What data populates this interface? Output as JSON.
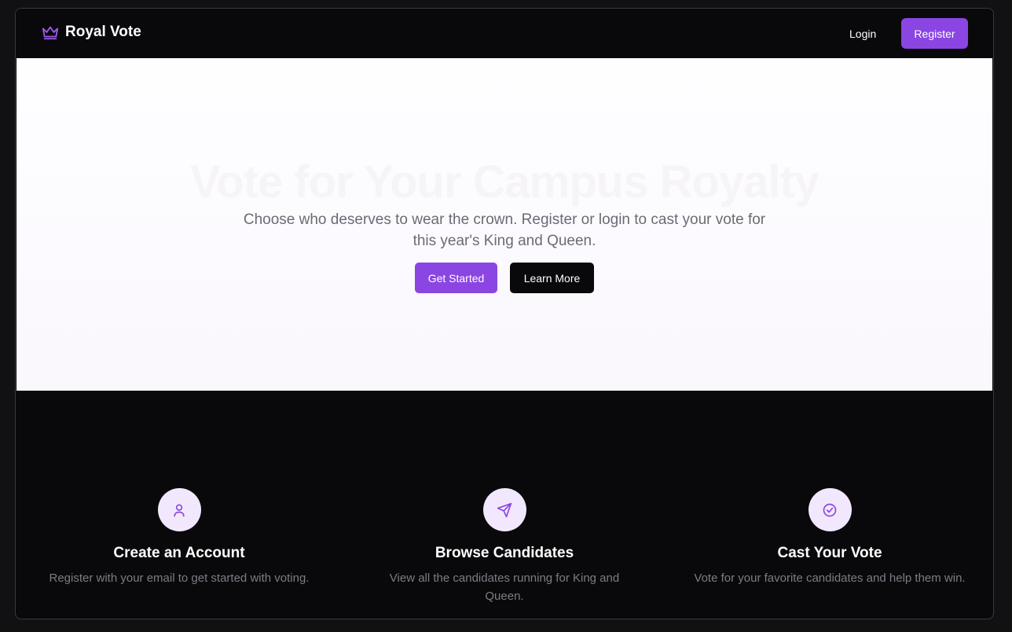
{
  "navbar": {
    "brand_icon": "crown-icon",
    "brand_name": "Royal Vote",
    "login_label": "Login",
    "register_label": "Register"
  },
  "hero": {
    "title": "Vote for Your Campus Royalty",
    "subtitle": "Choose who deserves to wear the crown. Register or login to cast your vote for this year's King and Queen.",
    "primary_button": "Get Started",
    "secondary_button": "Learn More"
  },
  "features": [
    {
      "icon": "user-icon",
      "title": "Create an Account",
      "description": "Register with your email to get started with voting."
    },
    {
      "icon": "send-icon",
      "title": "Browse Candidates",
      "description": "View all the candidates running for King and Queen."
    },
    {
      "icon": "check-circle-icon",
      "title": "Cast Your Vote",
      "description": "Vote for your favorite candidates and help them win."
    }
  ],
  "colors": {
    "accent": "#8b45e3",
    "background": "#09090b",
    "icon_bg": "#f2e8fd"
  }
}
